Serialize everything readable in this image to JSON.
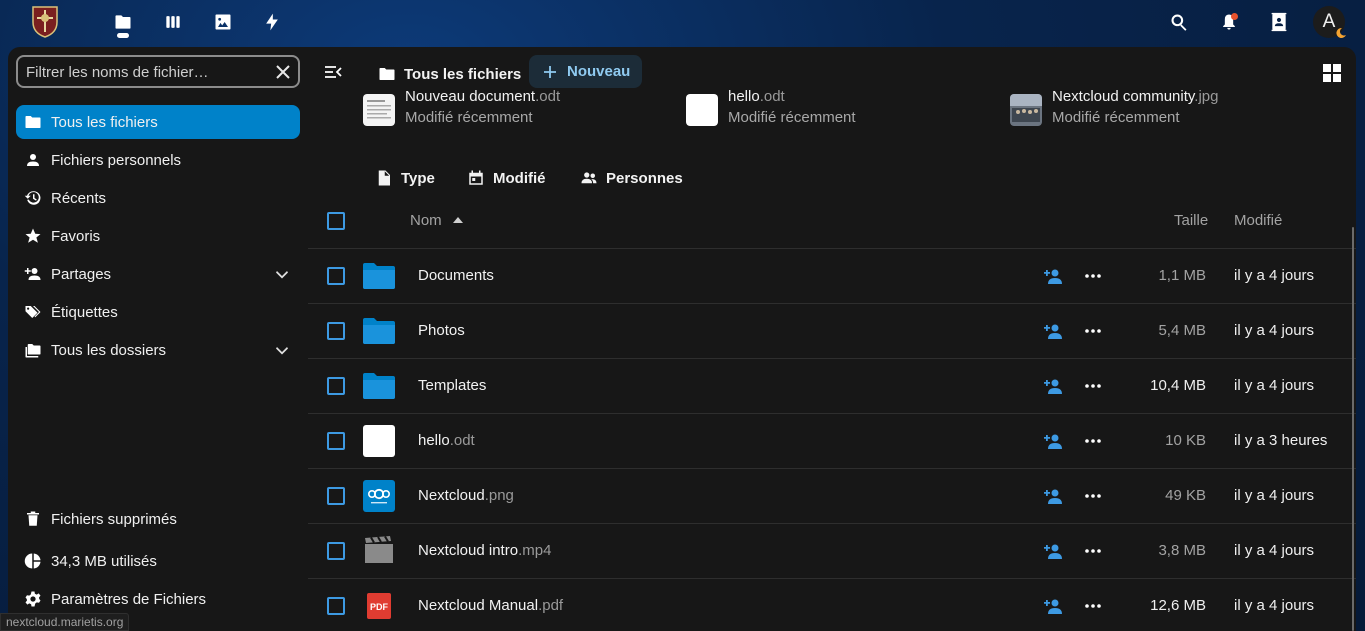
{
  "header": {
    "apps": [
      {
        "name": "files-icon"
      },
      {
        "name": "deck-icon"
      },
      {
        "name": "photos-icon"
      },
      {
        "name": "activity-icon"
      }
    ],
    "avatar_letter": "A"
  },
  "sidebar": {
    "filter_placeholder": "Filtrer les noms de fichier…",
    "items": [
      {
        "label": "Tous les fichiers",
        "icon": "folder-icon",
        "active": true
      },
      {
        "label": "Fichiers personnels",
        "icon": "person-icon"
      },
      {
        "label": "Récents",
        "icon": "history-icon"
      },
      {
        "label": "Favoris",
        "icon": "star-icon"
      },
      {
        "label": "Partages",
        "icon": "share-icon",
        "expandable": true
      },
      {
        "label": "Étiquettes",
        "icon": "tag-icon"
      },
      {
        "label": "Tous les dossiers",
        "icon": "folders-icon",
        "expandable": true
      }
    ],
    "footer": {
      "trash": "Fichiers supprimés",
      "quota": "34,3 MB utilisés",
      "settings": "Paramètres de Fichiers"
    }
  },
  "main": {
    "breadcrumb": "Tous les fichiers",
    "new_button": "Nouveau",
    "recent": [
      {
        "base": "Nouveau document",
        "ext": ".odt",
        "subtitle": "Modifié récemment"
      },
      {
        "base": "hello",
        "ext": ".odt",
        "subtitle": "Modifié récemment"
      },
      {
        "base": "Nextcloud community",
        "ext": ".jpg",
        "subtitle": "Modifié récemment"
      }
    ],
    "filters": {
      "type": "Type",
      "modified": "Modifié",
      "people": "Personnes"
    },
    "columns": {
      "name": "Nom",
      "size": "Taille",
      "modified": "Modifié"
    },
    "files": [
      {
        "base": "Documents",
        "ext": "",
        "kind": "folder",
        "size": "1,1 MB",
        "date": "il y a 4 jours"
      },
      {
        "base": "Photos",
        "ext": "",
        "kind": "folder",
        "size": "5,4 MB",
        "date": "il y a 4 jours"
      },
      {
        "base": "Templates",
        "ext": "",
        "kind": "folder",
        "size": "10,4 MB",
        "date": "il y a 4 jours"
      },
      {
        "base": "hello",
        "ext": ".odt",
        "kind": "doc",
        "size": "10 KB",
        "date": "il y a 3 heures"
      },
      {
        "base": "Nextcloud",
        "ext": ".png",
        "kind": "image",
        "size": "49 KB",
        "date": "il y a 4 jours"
      },
      {
        "base": "Nextcloud intro",
        "ext": ".mp4",
        "kind": "video",
        "size": "3,8 MB",
        "date": "il y a 4 jours"
      },
      {
        "base": "Nextcloud Manual",
        "ext": ".pdf",
        "kind": "pdf",
        "size": "12,6 MB",
        "date": "il y a 4 jours"
      }
    ]
  },
  "status_url": "nextcloud.marietis.org",
  "colors": {
    "accent": "#0082c9",
    "checkbox": "#3d9ae3",
    "folder": "#0082c9",
    "pdf": "#e03c31"
  }
}
